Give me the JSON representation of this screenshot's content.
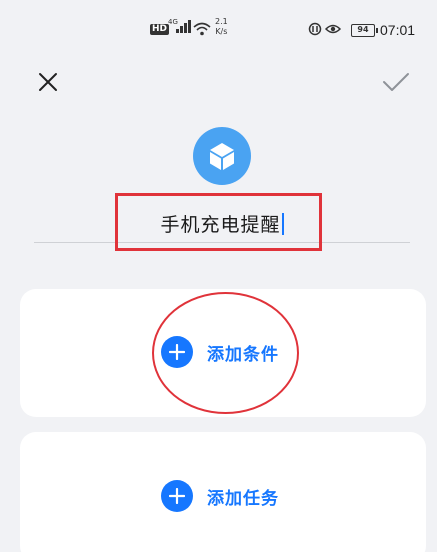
{
  "status_bar": {
    "hd_badge": "HD",
    "network_type": "4G",
    "speed_value": "2.1",
    "speed_unit": "K/s",
    "battery": "94",
    "time": "07:01"
  },
  "toolbar": {
    "close_icon": "close-icon",
    "confirm_icon": "check-icon"
  },
  "scene": {
    "icon": "cube-icon",
    "icon_color": "#4aa3f2",
    "name": "手机充电提醒"
  },
  "conditions": {
    "add_label": "添加条件"
  },
  "tasks": {
    "add_label": "添加任务"
  },
  "colors": {
    "accent": "#1677ff",
    "annotation_red": "#e0333a",
    "background": "#f1f2f5",
    "card": "#ffffff"
  }
}
